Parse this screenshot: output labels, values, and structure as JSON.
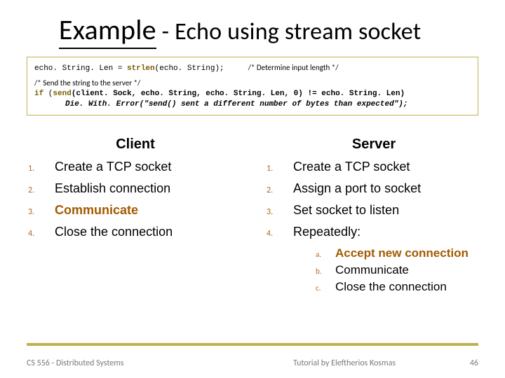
{
  "title": {
    "example": "Example",
    "rest": " - Echo using stream socket"
  },
  "code": {
    "l1a": "echo. String. Len = ",
    "l1b": "strlen",
    "l1c": "(echo. String);",
    "c1": "/* Determine input length */",
    "c2": "/* Send the string to the server */",
    "l2a": "if",
    "l2b": " (",
    "l2c": "send",
    "l2d": "(client. Sock, echo. String, echo. String. Len, 0) != echo. String. Len)",
    "l3": "Die. With. Error(\"send() sent a different number of bytes than expected\");"
  },
  "client": {
    "heading": "Client",
    "items": [
      "Create a TCP socket",
      "Establish connection",
      "Communicate",
      "Close the connection"
    ]
  },
  "server": {
    "heading": "Server",
    "items": [
      "Create a TCP socket",
      "Assign a port to socket",
      "Set socket to listen",
      "Repeatedly:"
    ],
    "sub": [
      "Accept new connection",
      "Communicate",
      "Close the connection"
    ]
  },
  "nums": [
    "1.",
    "2.",
    "3.",
    "4."
  ],
  "letters": [
    "a.",
    "b.",
    "c."
  ],
  "footer": {
    "left": "CS 556 - Distributed Systems",
    "mid": "Tutorial by Eleftherios Kosmas",
    "page": "46"
  }
}
